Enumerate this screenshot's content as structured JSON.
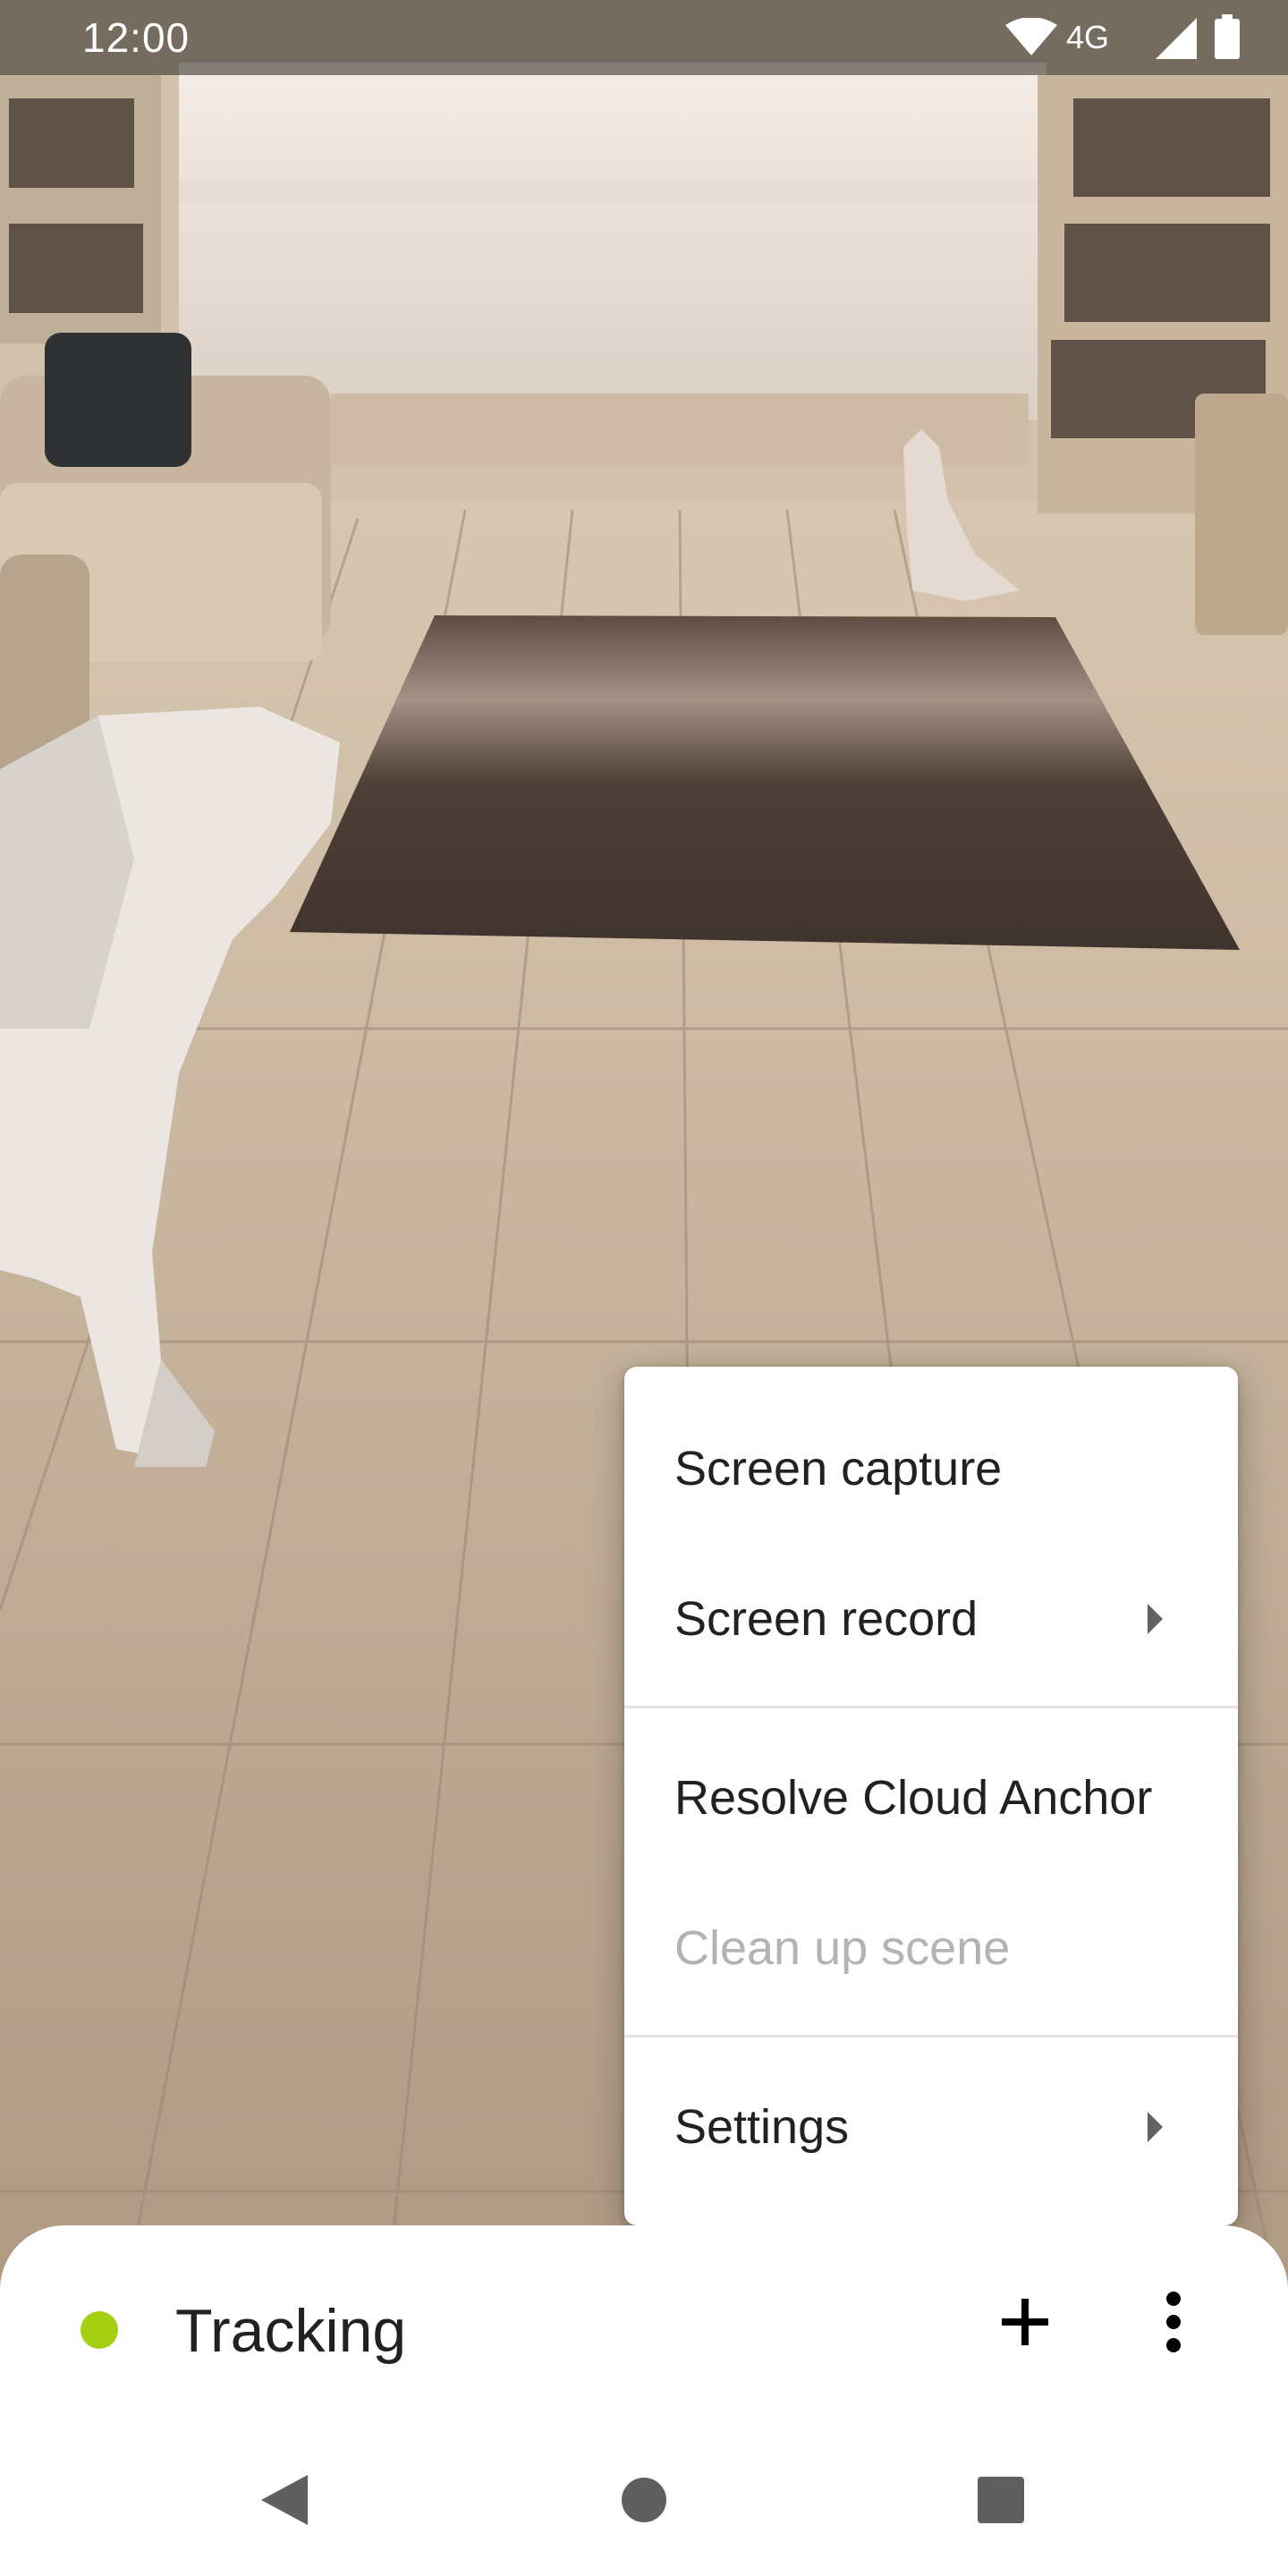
{
  "status_bar": {
    "time": "12:00",
    "network": "4G",
    "icons": [
      "wifi-icon",
      "cell-signal-icon",
      "battery-icon"
    ]
  },
  "overflow_menu": {
    "items": [
      {
        "label": "Screen capture",
        "has_submenu": false,
        "enabled": true
      },
      {
        "label": "Screen record",
        "has_submenu": true,
        "enabled": true
      },
      {
        "label": "Resolve Cloud Anchor",
        "has_submenu": false,
        "enabled": true
      },
      {
        "label": "Clean up scene",
        "has_submenu": false,
        "enabled": false
      },
      {
        "label": "Settings",
        "has_submenu": true,
        "enabled": true
      }
    ]
  },
  "bottom_sheet": {
    "status_label": "Tracking",
    "status_color": "#a5cf13",
    "add_icon": "plus-icon",
    "more_icon": "more-vert-icon"
  },
  "nav_bar": {
    "icons": [
      "back-icon",
      "home-icon",
      "recents-icon"
    ]
  }
}
